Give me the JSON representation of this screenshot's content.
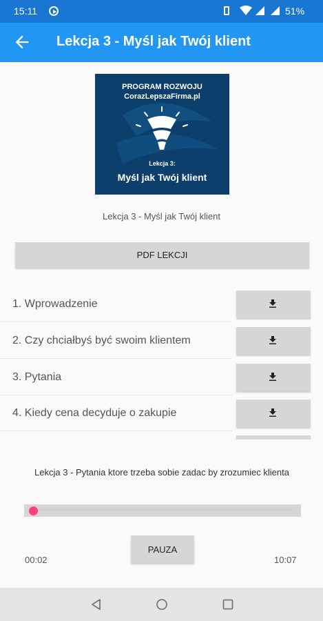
{
  "status_bar": {
    "time": "15:11",
    "battery": "51%",
    "icons": [
      "record-icon",
      "vibrate-icon",
      "wifi-icon",
      "signal-icon",
      "signal-icon",
      "battery-icon"
    ]
  },
  "app_bar": {
    "back_icon": "arrow-left-icon",
    "title": "Lekcja 3 - Myśl jak Twój klient"
  },
  "cover": {
    "line1": "PROGRAM ROZWOJU",
    "line2": "CorazLepszaFirma.pl",
    "line3": "Lekcja 3:",
    "line4": "Myśl jak Twój klient"
  },
  "caption": "Lekcja 3 - Myśl jak Twój klient",
  "pdf_button": "PDF LEKCJI",
  "lessons": [
    {
      "label": "1. Wprowadzenie"
    },
    {
      "label": "2. Czy chciałbyś być swoim klientem"
    },
    {
      "label": "3. Pytania"
    },
    {
      "label": "4. Kiedy cena decyduje o zakupie"
    },
    {
      "label": ""
    }
  ],
  "player": {
    "track_title": "Lekcja 3 - Pytania ktore trzeba sobie zadac by zrozumiec klienta",
    "progress_fraction": 0.003,
    "pause_label": "PAUZA",
    "current_time": "00:02",
    "duration": "10:07"
  },
  "colors": {
    "status_bar": "#1976d2",
    "app_bar": "#2196f3",
    "accent": "#ff4081"
  }
}
